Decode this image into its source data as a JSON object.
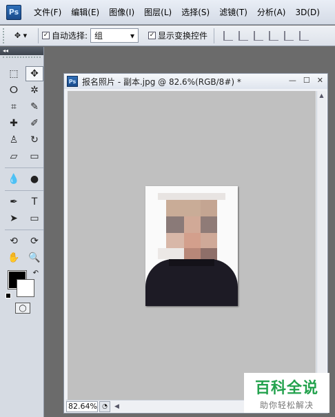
{
  "app": {
    "logo": "Ps"
  },
  "menu": [
    "文件(F)",
    "编辑(E)",
    "图像(I)",
    "图层(L)",
    "选择(S)",
    "滤镜(T)",
    "分析(A)",
    "3D(D)"
  ],
  "options": {
    "tool_preset_icon": "move-tool-icon",
    "auto_select_checked": "✓",
    "auto_select_label": "自动选择:",
    "auto_select_value": "组",
    "show_transform_checked": "✓",
    "show_transform_label": "显示变换控件"
  },
  "tools_panel": {
    "collapse": "◂◂",
    "tools": [
      {
        "name": "rect-marquee-icon",
        "glyph": "⬚"
      },
      {
        "name": "move-icon",
        "glyph": "✥"
      },
      {
        "name": "lasso-icon",
        "glyph": "ⵔ"
      },
      {
        "name": "magic-wand-icon",
        "glyph": "✲"
      },
      {
        "name": "crop-icon",
        "glyph": "⌗"
      },
      {
        "name": "eyedropper-icon",
        "glyph": "✎"
      },
      {
        "name": "healing-brush-icon",
        "glyph": "✚"
      },
      {
        "name": "brush-icon",
        "glyph": "✐"
      },
      {
        "name": "stamp-icon",
        "glyph": "♙"
      },
      {
        "name": "history-brush-icon",
        "glyph": "↻"
      },
      {
        "name": "eraser-icon",
        "glyph": "▱"
      },
      {
        "name": "gradient-icon",
        "glyph": "▭"
      },
      {
        "name": "blur-icon",
        "glyph": "💧"
      },
      {
        "name": "dodge-icon",
        "glyph": "●"
      },
      {
        "name": "pen-icon",
        "glyph": "✒"
      },
      {
        "name": "type-icon",
        "glyph": "T"
      },
      {
        "name": "path-select-icon",
        "glyph": "➤"
      },
      {
        "name": "shape-icon",
        "glyph": "▭"
      },
      {
        "name": "3d-rotate-icon",
        "glyph": "⟲"
      },
      {
        "name": "3d-orbit-icon",
        "glyph": "⟳"
      },
      {
        "name": "hand-icon",
        "glyph": "✋"
      },
      {
        "name": "zoom-icon",
        "glyph": "🔍"
      }
    ],
    "swap_colors": "↶",
    "quick_mask": "◯"
  },
  "document": {
    "icon": "Ps",
    "title": "报名照片 - 副本.jpg @ 82.6%(RGB/8#) *",
    "minimize": "—",
    "maximize": "☐",
    "close": "✕",
    "zoom": "82.64%",
    "status_icon": "◔",
    "scroll_up": "▲",
    "scroll_left": "◀"
  },
  "watermark": {
    "title": "百科全说",
    "subtitle": "助你轻松解决"
  }
}
